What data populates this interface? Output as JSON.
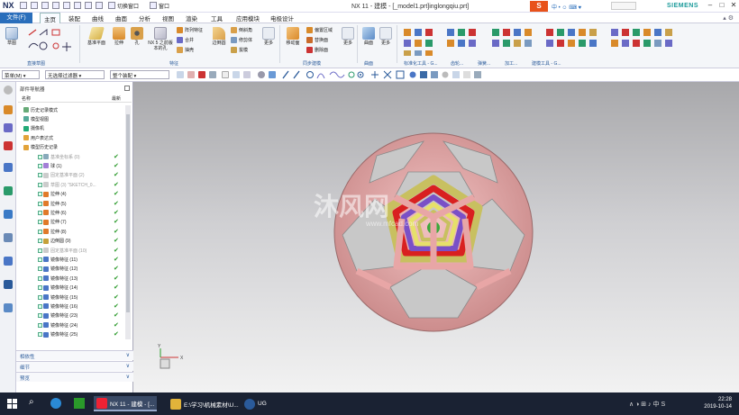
{
  "titlebar": {
    "app_logo": "NX",
    "switch_window": "切换窗口",
    "window_menu": "窗口",
    "title": "NX 11 - 建模 - [_model1.prt]inglongqiu.prt]",
    "brand": "SIEMENS",
    "sohu_logo": "S",
    "sys_icons": "中 • ☺ ⌨ ♥"
  },
  "menubar": {
    "file": "文件(F)",
    "items": [
      "主页",
      "装配",
      "曲线",
      "曲面",
      "分析",
      "视图",
      "渲染",
      "工具",
      "应用模块",
      "电极设计"
    ]
  },
  "ribbon": {
    "sketch": "草图",
    "datum": "基准平面",
    "extrude": "拉伸",
    "hole": "孔",
    "nx5": "NX 5 之前版本的孔",
    "pattern_feature": "阵列特征",
    "unite": "合并",
    "shell": "抽壳",
    "edge_blend": "边倒圆",
    "chamfer": "倒斜角",
    "trim_body": "修剪体",
    "draft": "拔模",
    "more1": "更多",
    "move_face": "移动面",
    "offset_region": "偏置区域",
    "replace_face": "替换面",
    "delete_face": "删除面",
    "more2": "更多",
    "surface": "曲面",
    "more3": "更多",
    "groups": {
      "direct_sketch": "直接草图",
      "feature": "特征",
      "sync_modeling": "同步建模",
      "surface": "曲面",
      "std_tools": "标准化工具 - G...",
      "gear": "齿轮...",
      "spring": "弹簧...",
      "machining": "加工...",
      "model_tools": "建模工具 - G..."
    }
  },
  "toolbar2": {
    "menu": "菜单(M)",
    "filter": "无选择过滤器",
    "assembly": "整个装配"
  },
  "nav": {
    "title": "部件导航器",
    "col_name": "名称",
    "col_latest": "最新",
    "rows": [
      {
        "label": "历史记录模式",
        "color": "#6a7",
        "indent": 6,
        "grey": false,
        "check": false,
        "cb": false
      },
      {
        "label": "模型视图",
        "color": "#5a9",
        "indent": 6,
        "grey": false,
        "check": false,
        "cb": false
      },
      {
        "label": "摄像机",
        "color": "#2a7",
        "indent": 6,
        "grey": false,
        "check": false,
        "cb": false
      },
      {
        "label": "用户表达式",
        "color": "#e2a33a",
        "indent": 6,
        "grey": false,
        "check": false,
        "cb": false
      },
      {
        "label": "模型历史记录",
        "color": "#e2a33a",
        "indent": 6,
        "grey": false,
        "check": false,
        "cb": false
      },
      {
        "label": "基准坐标系 (0)",
        "color": "#8ab",
        "indent": 22,
        "grey": true,
        "check": true,
        "cb": true
      },
      {
        "label": "球 (1)",
        "color": "#a37fd6",
        "indent": 22,
        "grey": false,
        "check": true,
        "cb": true
      },
      {
        "label": "固定基准平面 (2)",
        "color": "#ccc",
        "indent": 22,
        "grey": true,
        "check": true,
        "cb": true
      },
      {
        "label": "草图 (3) \"SKETCH_0...",
        "color": "#ccc",
        "indent": 22,
        "grey": true,
        "check": true,
        "cb": true
      },
      {
        "label": "拉伸 (4)",
        "color": "#e07a2a",
        "indent": 22,
        "grey": false,
        "check": true,
        "cb": true
      },
      {
        "label": "拉伸 (5)",
        "color": "#e07a2a",
        "indent": 22,
        "grey": false,
        "check": true,
        "cb": true
      },
      {
        "label": "拉伸 (6)",
        "color": "#e07a2a",
        "indent": 22,
        "grey": false,
        "check": true,
        "cb": true
      },
      {
        "label": "拉伸 (7)",
        "color": "#e07a2a",
        "indent": 22,
        "grey": false,
        "check": true,
        "cb": true
      },
      {
        "label": "拉伸 (8)",
        "color": "#e07a2a",
        "indent": 22,
        "grey": false,
        "check": true,
        "cb": true
      },
      {
        "label": "边倒圆 (9)",
        "color": "#c6a13a",
        "indent": 22,
        "grey": false,
        "check": true,
        "cb": true
      },
      {
        "label": "固定基准平面 (10)",
        "color": "#ccc",
        "indent": 22,
        "grey": true,
        "check": true,
        "cb": true
      },
      {
        "label": "镜像特征 (11)",
        "color": "#4a76c6",
        "indent": 22,
        "grey": false,
        "check": true,
        "cb": true
      },
      {
        "label": "镜像特征 (12)",
        "color": "#4a76c6",
        "indent": 22,
        "grey": false,
        "check": true,
        "cb": true
      },
      {
        "label": "镜像特征 (13)",
        "color": "#4a76c6",
        "indent": 22,
        "grey": false,
        "check": true,
        "cb": true
      },
      {
        "label": "镜像特征 (14)",
        "color": "#4a76c6",
        "indent": 22,
        "grey": false,
        "check": true,
        "cb": true
      },
      {
        "label": "镜像特征 (15)",
        "color": "#4a76c6",
        "indent": 22,
        "grey": false,
        "check": true,
        "cb": true
      },
      {
        "label": "镜像特征 (16)",
        "color": "#4a76c6",
        "indent": 22,
        "grey": false,
        "check": true,
        "cb": true
      },
      {
        "label": "镜像特征 (23)",
        "color": "#4a76c6",
        "indent": 22,
        "grey": false,
        "check": true,
        "cb": true
      },
      {
        "label": "镜像特征 (24)",
        "color": "#4a76c6",
        "indent": 22,
        "grey": false,
        "check": true,
        "cb": true
      },
      {
        "label": "镜像特征 (25)",
        "color": "#4a76c6",
        "indent": 22,
        "grey": false,
        "check": true,
        "cb": true
      }
    ],
    "accordions": [
      "相依性",
      "细节",
      "预览"
    ]
  },
  "viewport": {
    "watermark": "沐风网",
    "watermark_url": "www.mfcad.com",
    "axis_x": "X",
    "axis_y": "Y"
  },
  "taskbar": {
    "items": [
      "NX 11 - 建模 - [...",
      "E:\\学习\\机械素材\\U...",
      "UG"
    ],
    "time": "22:28",
    "date": "2019-10-14",
    "sys": "∧ ◑ ⊞ ♪ 中 S"
  }
}
